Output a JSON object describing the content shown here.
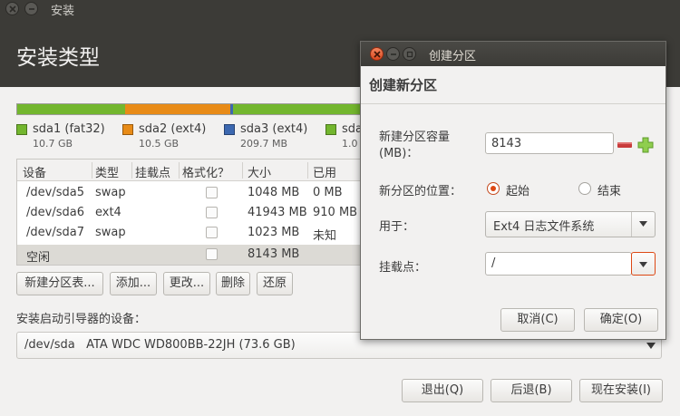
{
  "window": {
    "title": "安装",
    "header": "安装类型"
  },
  "partition_bar": [
    {
      "label": "sda1 (fat32)",
      "size": "10.7 GB",
      "color": "#73b62e",
      "fraction": 0.316
    },
    {
      "label": "sda2 (ext4)",
      "size": "10.5 GB",
      "color": "#e88b17",
      "fraction": 0.307
    },
    {
      "label": "sda3 (ext4)",
      "size": "209.7 MB",
      "color": "#3c68b0",
      "fraction": 0.008
    },
    {
      "label": "sda",
      "size": "1.0",
      "color": "#73b62e",
      "fraction": 0.369
    }
  ],
  "table": {
    "headers": [
      "设备",
      "类型",
      "挂载点",
      "格式化？",
      "大小",
      "已用"
    ],
    "rows": [
      {
        "device": "/dev/sda5",
        "type": "swap",
        "mount": "",
        "size": "1048 MB",
        "used": "0 MB"
      },
      {
        "device": "/dev/sda6",
        "type": "ext4",
        "mount": "",
        "size": "41943 MB",
        "used": "910 MB"
      },
      {
        "device": "/dev/sda7",
        "type": "swap",
        "mount": "",
        "size": "1023 MB",
        "used": "未知"
      },
      {
        "device": "空闲",
        "type": "",
        "mount": "",
        "size": "8143 MB",
        "used": ""
      }
    ]
  },
  "table_buttons": {
    "new_table": "新建分区表...",
    "add": "添加...",
    "change": "更改...",
    "delete": "删除",
    "revert": "还原"
  },
  "boot": {
    "label": "安装启动引导器的设备：",
    "device": "/dev/sda",
    "description": "ATA WDC WD800BB-22JH (73.6 GB)"
  },
  "footer_buttons": {
    "quit": "退出(Q)",
    "back": "后退(B)",
    "install": "现在安装(I)"
  },
  "dialog": {
    "title": "创建分区",
    "heading": "创建新分区",
    "size_label_1": "新建分区容量",
    "size_label_2": "(MB)：",
    "size_value": "8143",
    "location_label": "新分区的位置：",
    "location_begin": "起始",
    "location_end": "结束",
    "use_label": "用于：",
    "use_value": "Ext4 日志文件系统",
    "mount_label": "挂载点：",
    "mount_value": "/",
    "cancel": "取消(C)",
    "ok": "确定(O)"
  },
  "colors": {
    "header_bg": "#3c3b37",
    "accent": "#dd4814",
    "window_bg": "#f2f1f0"
  }
}
